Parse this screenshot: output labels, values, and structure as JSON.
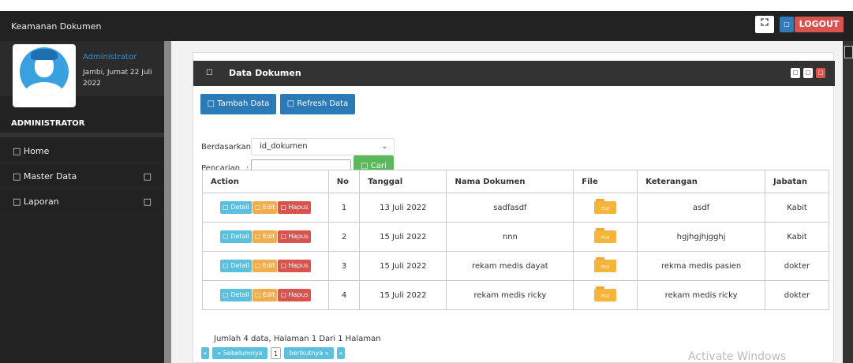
{
  "nav": {
    "brand": "Keamanan Dokumen",
    "fullscreen_icon": "expand-icon",
    "square_icon": "square-icon",
    "logout": "LOGOUT",
    "box_glyph": "□"
  },
  "profile": {
    "name": "Administrator",
    "date": "Jambi, Jumat 22 Juli 2022"
  },
  "sidebar": {
    "role": "ADMINISTRATOR",
    "items": [
      {
        "label": "□ Home",
        "arrow": ""
      },
      {
        "label": "□ Master Data",
        "arrow": "□"
      },
      {
        "label": "□ Laporan",
        "arrow": "□"
      }
    ]
  },
  "panel": {
    "title": "Data Dokumen",
    "title_icon": "□",
    "window_buttons": [
      "□",
      "□",
      "□"
    ],
    "add_button": "□ Tambah Data",
    "refresh_button": "□ Refresh Data",
    "filter_label": "Berdasarkan:",
    "filter_value": "id_dokumen",
    "search_label": "Pencarian",
    "search_colon": ":",
    "search_value": "",
    "search_button": "□ Cari"
  },
  "table": {
    "headers": [
      "Action",
      "No",
      "Tanggal",
      "Nama Dokumen",
      "File",
      "Keterangan",
      "Jabatan"
    ],
    "action_labels": {
      "detail": "□ Detail",
      "edit": "□ Edit",
      "delete": "□ Hapus"
    },
    "file_label": "FILE",
    "rows": [
      {
        "no": "1",
        "tanggal": "13 Juli 2022",
        "nama": "sadfasdf",
        "keterangan": "asdf",
        "jabatan": "Kabit"
      },
      {
        "no": "2",
        "tanggal": "15 Juli 2022",
        "nama": "nnn",
        "keterangan": "hgjhgjhjgghj",
        "jabatan": "Kabit"
      },
      {
        "no": "3",
        "tanggal": "15 Juli 2022",
        "nama": "rekam medis dayat",
        "keterangan": "rekma medis pasien",
        "jabatan": "dokter"
      },
      {
        "no": "4",
        "tanggal": "15 Juli 2022",
        "nama": "rekam medis ricky",
        "keterangan": "rekam medis ricky",
        "jabatan": "dokter"
      }
    ]
  },
  "summary": "Jumlah 4 data, Halaman 1 Dari 1 Halaman",
  "pagination": {
    "first": "«",
    "prev": "« Sebelumnya",
    "page": "1",
    "next": "berikutnya »",
    "last": "»"
  },
  "watermark": "Activate Windows",
  "colors": {
    "logout": "#d9534f",
    "primary": "#2a7ab8",
    "success": "#5cb85c",
    "info": "#5bc0de",
    "warning": "#f0ad4e",
    "danger": "#d9534f"
  }
}
